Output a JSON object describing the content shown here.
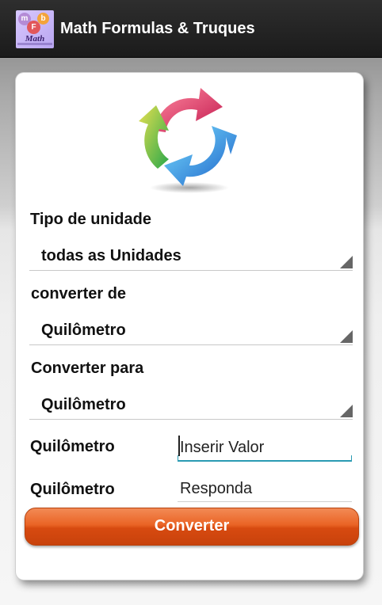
{
  "app": {
    "title": "Math Formulas & Truques",
    "icon_text": "Math"
  },
  "form": {
    "unit_type_label": "Tipo de unidade",
    "unit_type_value": "todas as Unidades",
    "from_label": "converter de",
    "from_value": "Quilômetro",
    "to_label": "Converter para",
    "to_value": "Quilômetro",
    "input_unit_label": "Quilômetro",
    "input_placeholder": "Inserir Valor",
    "output_unit_label": "Quilômetro",
    "output_text": "Responda",
    "convert_button": "Converter"
  },
  "colors": {
    "button": "#e05a1a",
    "accent": "#2a9bb3",
    "appbar": "#222222"
  }
}
